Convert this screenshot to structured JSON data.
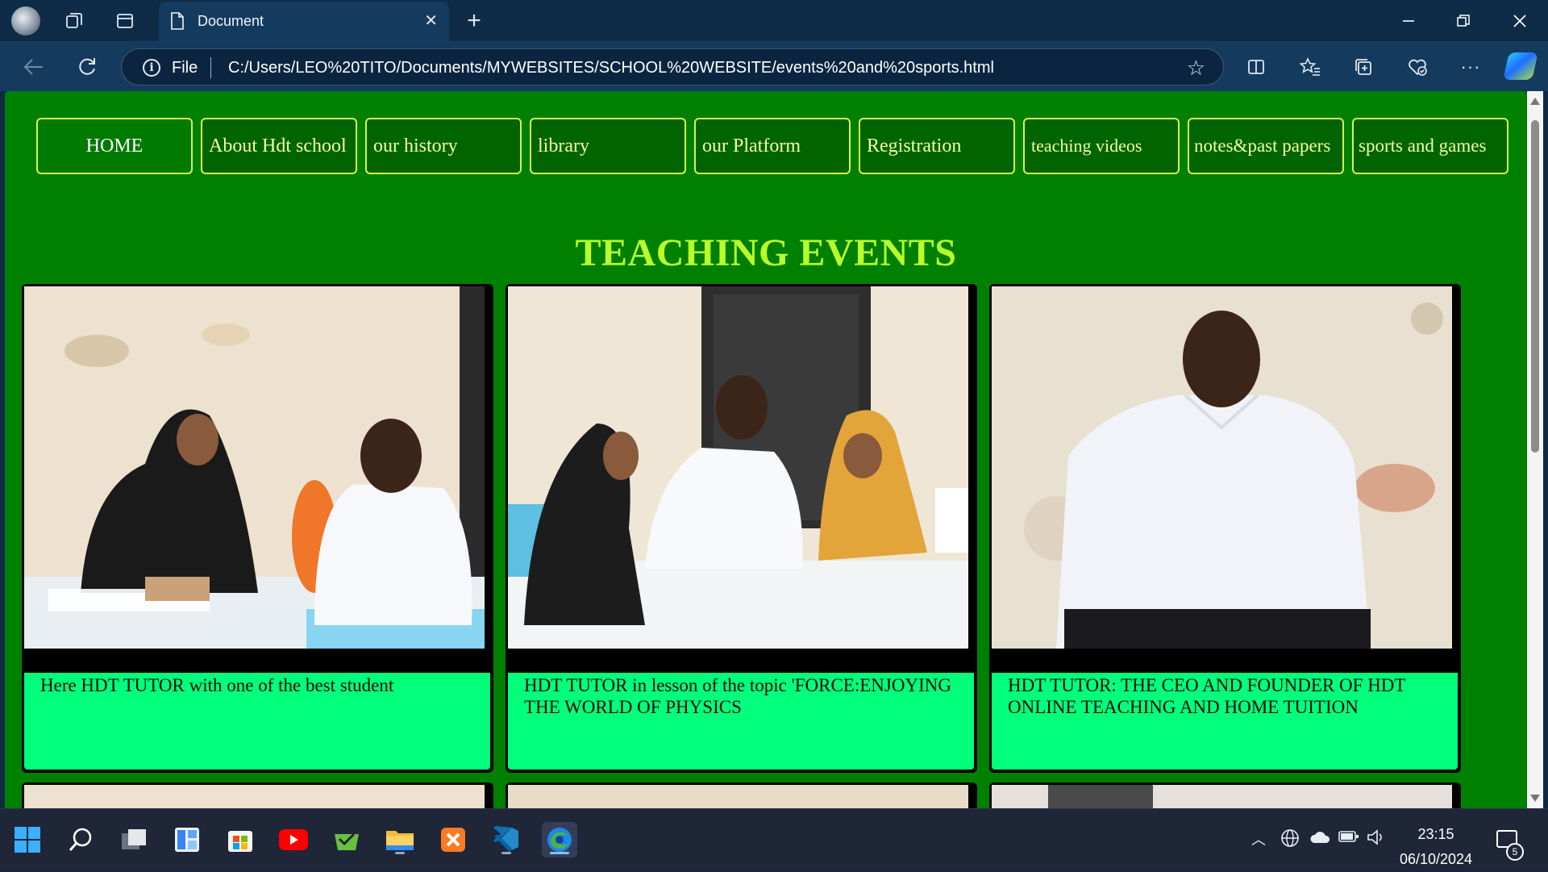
{
  "browser": {
    "tab_title": "Document",
    "address_prefix": "File",
    "url": "C:/Users/LEO%20TITO/Documents/MYWEBSITES/SCHOOL%20WEBSITE/events%20and%20sports.html"
  },
  "site": {
    "menu": [
      {
        "label": "HOME"
      },
      {
        "label": "About Hdt school"
      },
      {
        "label": "our history"
      },
      {
        "label": "library"
      },
      {
        "label": "our Platform"
      },
      {
        "label": "Registration"
      },
      {
        "label": "teaching videos"
      },
      {
        "label": "notes&past papers"
      },
      {
        "label": "sports and games"
      }
    ],
    "heading": "TEACHING EVENTS",
    "cards": [
      {
        "caption": "Here HDT TUTOR with one of the best student"
      },
      {
        "caption": "HDT TUTOR in lesson of the topic 'FORCE:ENJOYING THE WORLD OF PHYSICS"
      },
      {
        "caption": "HDT TUTOR: THE CEO AND FOUNDER OF HDT ONLINE TEACHING AND HOME TUITION"
      }
    ]
  },
  "taskbar": {
    "time": "23:15",
    "date": "06/10/2024",
    "notification_count": "5"
  },
  "colors": {
    "page_bg": "#008000",
    "menu_border": "#d7f34a",
    "heading": "#b9ff2a",
    "caption_bg": "#00ff7b"
  },
  "icons": [
    "profile-icon",
    "workspaces-icon",
    "tab-actions-icon",
    "document-icon",
    "close-icon",
    "new-tab-icon",
    "minimize-icon",
    "restore-icon",
    "back-icon",
    "refresh-icon",
    "info-icon",
    "favorite-star-icon",
    "split-screen-icon",
    "favorites-icon",
    "collections-icon",
    "browser-essentials-icon",
    "more-icon",
    "copilot-icon",
    "start-icon",
    "search-icon",
    "task-view-icon",
    "widgets-icon",
    "store-icon",
    "youtube-icon",
    "xampp-icon",
    "file-explorer-icon",
    "vscode-icon",
    "edge-icon",
    "chevron-up-icon",
    "globe-icon",
    "onedrive-icon",
    "battery-icon",
    "volume-icon",
    "notification-icon"
  ]
}
